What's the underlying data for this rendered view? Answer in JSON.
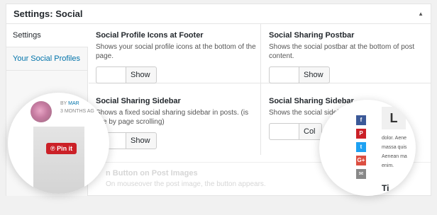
{
  "panel": {
    "title": "Settings: Social",
    "toggle_icon": "triangle-up-icon"
  },
  "tabs": [
    {
      "label": "Settings",
      "active": true
    },
    {
      "label": "Your Social Profiles",
      "active": false
    }
  ],
  "fields": [
    {
      "title": "Social Profile Icons at Footer",
      "description": "Shows your social profile icons at the bottom of the page.",
      "toggle_label": "Show"
    },
    {
      "title": "Social Sharing Postbar",
      "description": "Shows the social postbar at the bottom of post content.",
      "toggle_label": "Show"
    },
    {
      "title": "Social Sharing Sidebar",
      "description": "Shows a fixed social sharing sidebar in posts. (is",
      "description2": "ible by page scrolling)",
      "toggle_label": "Show"
    },
    {
      "title": "Social Sharing Sidebar",
      "description": "Shows the social sidebar",
      "toggle_label": "Col"
    }
  ],
  "faded_field": {
    "title": "n Button on Post Images",
    "description": "On mouseover the post image, the button appears."
  },
  "bubble_left": {
    "byline_prefix": "BY",
    "author": "MAR",
    "date": "3 MONTHS AG",
    "pin_label": "Pin it",
    "pin_icon": "pinterest-icon"
  },
  "bubble_right": {
    "avatar_letter": "L",
    "share_icons": [
      "facebook-icon",
      "pinterest-icon",
      "twitter-icon",
      "google-plus-icon",
      "mail-icon"
    ],
    "share_glyphs": [
      "f",
      "P",
      "t",
      "G+",
      "✉"
    ],
    "text_lines": [
      "dolor. Aene",
      "massa quis",
      "Aenean ma",
      "enim."
    ],
    "heading": "Ti"
  },
  "colors": {
    "link": "#0073aa",
    "pinterest": "#cb2027",
    "facebook": "#3b5998",
    "twitter": "#1da1f2",
    "google_plus": "#dc4e41"
  }
}
